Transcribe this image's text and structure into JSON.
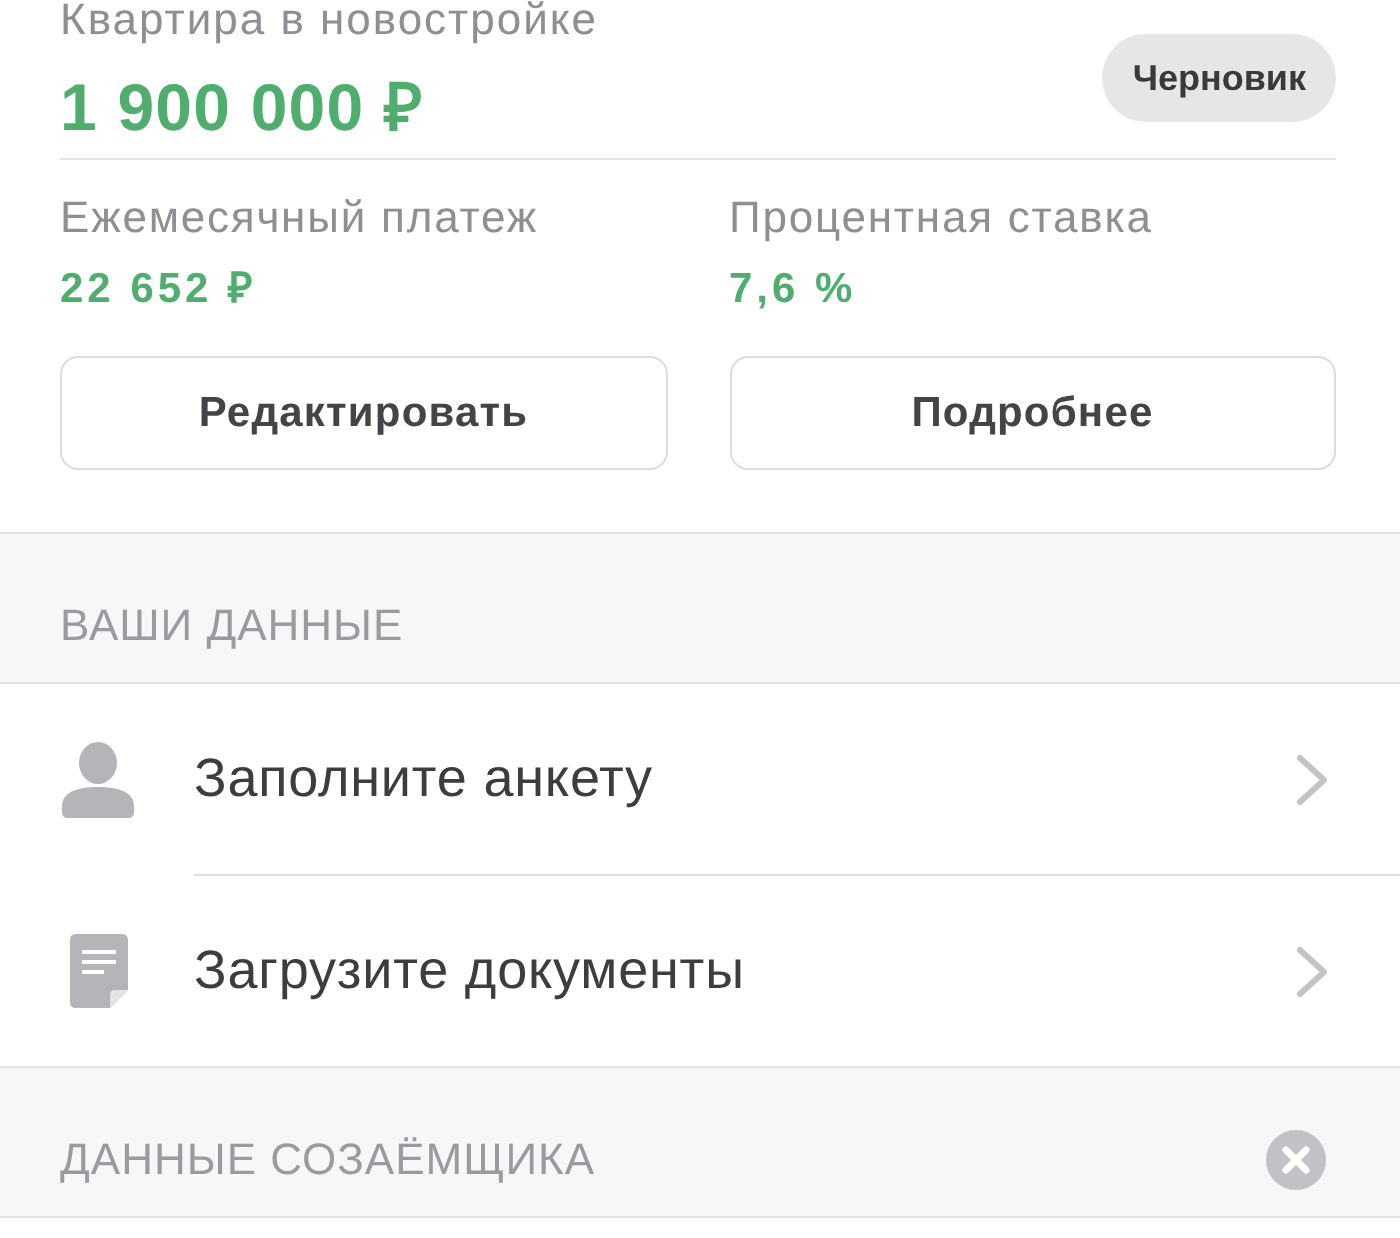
{
  "loan": {
    "title": "Квартира в новостройке",
    "amount": "1 900 000 ₽",
    "status": "Черновик"
  },
  "details": [
    {
      "label": "Ежемесячный платеж",
      "value": "22 652 ₽"
    },
    {
      "label": "Процентная ставка",
      "value": "7,6 %"
    }
  ],
  "actions": [
    {
      "label": "Редактировать"
    },
    {
      "label": "Подробнее"
    }
  ],
  "sections": [
    {
      "title": "ВАШИ ДАННЫЕ",
      "removable": false,
      "items": [
        {
          "kind": "questionnaire",
          "label": "Заполните анкету"
        },
        {
          "kind": "documents",
          "label": "Загрузите документы"
        }
      ]
    },
    {
      "title": "ДАННЫЕ СОЗАЁМЩИКА",
      "removable": true
    }
  ]
}
